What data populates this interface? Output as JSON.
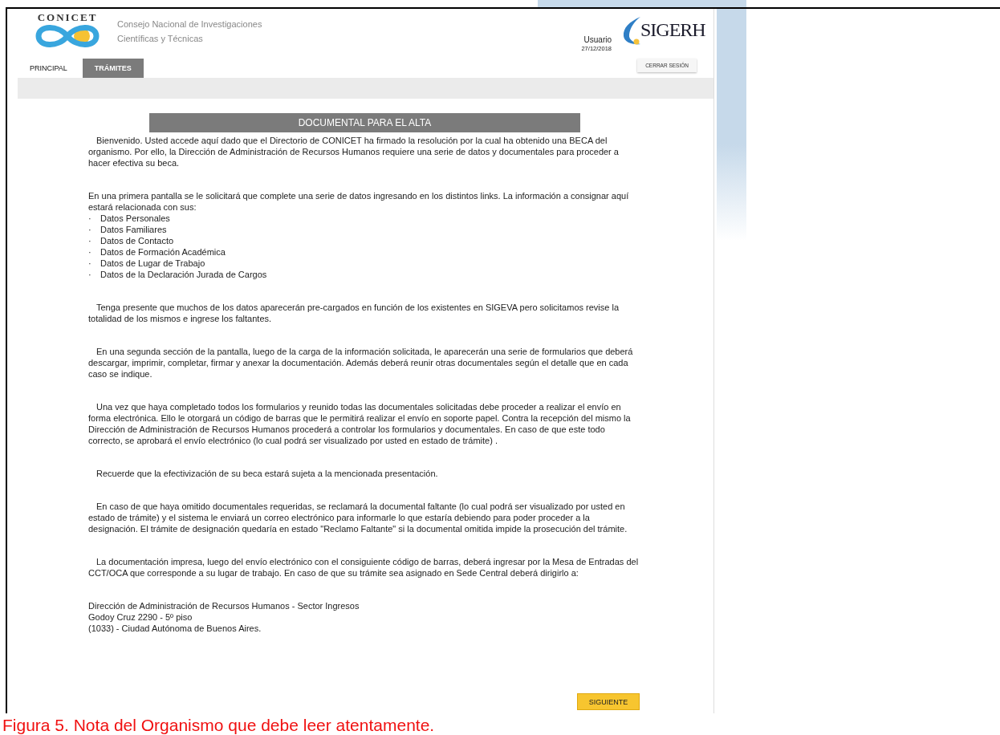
{
  "header": {
    "org_wordmark": "CONICET",
    "org_name_lines": [
      "Consejo Nacional de Investigaciones",
      "Científicas y Técnicas"
    ],
    "user": "Usuario",
    "date": "27/12/2018",
    "app_wordmark": "SIGERH"
  },
  "tabs": [
    {
      "label": "PRINCIPAL",
      "selected": false
    },
    {
      "label": "TRÁMITES",
      "selected": true
    }
  ],
  "logout_button": "CERRAR SESIÓN",
  "section_title": "DOCUMENTAL PARA EL ALTA",
  "content": [
    {
      "kind": "paragraph",
      "indent": true,
      "text": "Bienvenido. Usted accede aquí dado que el Directorio de CONICET ha firmado la resolución por la cual ha obtenido una BECA del organismo. Por ello, la Dirección de Administración de Recursos Humanos requiere una serie de datos y documentales para proceder a hacer efectiva su beca."
    },
    {
      "kind": "paragraph",
      "indent": false,
      "text": "En una primera pantalla se le solicitará que complete una serie de datos ingresando en los distintos links. La información a consignar aquí estará relacionada con sus:"
    },
    {
      "kind": "list",
      "items": [
        {
          "bullet": "·",
          "text": "Datos Personales"
        },
        {
          "bullet": "·",
          "text": "Datos Familiares"
        },
        {
          "bullet": "·",
          "text": "Datos de Contacto"
        },
        {
          "bullet": "·",
          "text": "Datos de Formación Académica"
        },
        {
          "bullet": "·",
          "text": "Datos de Lugar de Trabajo"
        },
        {
          "bullet": "·",
          "text": "Datos de la Declaración Jurada de Cargos"
        }
      ]
    },
    {
      "kind": "paragraph",
      "indent": true,
      "text": "Tenga presente que muchos de los datos aparecerán pre-cargados en función de los existentes en SIGEVA pero solicitamos revise la totalidad de los mismos e ingrese los faltantes."
    },
    {
      "kind": "paragraph",
      "indent": true,
      "text": "En una segunda sección de la pantalla, luego de la carga de la información solicitada, le aparecerán una serie de formularios que deberá descargar, imprimir, completar, firmar y anexar la documentación. Además deberá reunir otras documentales según el detalle que en cada caso se indique."
    },
    {
      "kind": "paragraph",
      "indent": true,
      "text": "Una vez que haya completado todos los formularios y reunido todas las documentales solicitadas debe proceder a realizar el envío en forma electrónica. Ello le otorgará un código de barras que le permitirá realizar el envío en soporte papel. Contra la recepción del mismo la Dirección de Administración de Recursos Humanos procederá a controlar los formularios y documentales. En caso de que este todo correcto, se aprobará el envío electrónico (lo cual podrá ser visualizado por usted en estado de trámite) ."
    },
    {
      "kind": "paragraph",
      "indent": true,
      "text": "Recuerde que la efectivización de su beca estará sujeta a la mencionada presentación."
    },
    {
      "kind": "paragraph",
      "indent": true,
      "text": "En caso de que haya omitido documentales requeridas, se reclamará la documental faltante (lo cual podrá ser visualizado por usted en estado de trámite) y el sistema le enviará un correo electrónico para informarle lo que estaría debiendo para poder proceder a la designación. El trámite de designación quedaría en estado \"Reclamo Faltante\" si la documental omitida impide la prosecución del trámite."
    },
    {
      "kind": "paragraph",
      "indent": true,
      "text": "La documentación impresa, luego del envío electrónico con el consiguiente código de barras, deberá ingresar por la Mesa de Entradas del CCT/OCA que corresponde a su lugar de trabajo. En caso de que su trámite sea asignado en Sede Central deberá dirigirlo a:"
    },
    {
      "kind": "address",
      "lines": [
        "Dirección de Administración de Recursos Humanos - Sector Ingresos",
        "Godoy Cruz 2290 - 5º piso",
        "(1033) - Ciudad Autónoma de Buenos Aires."
      ]
    }
  ],
  "next_button": "SIGUIENTE",
  "caption": "Figura 5. Nota del Organismo que debe leer atentamente."
}
